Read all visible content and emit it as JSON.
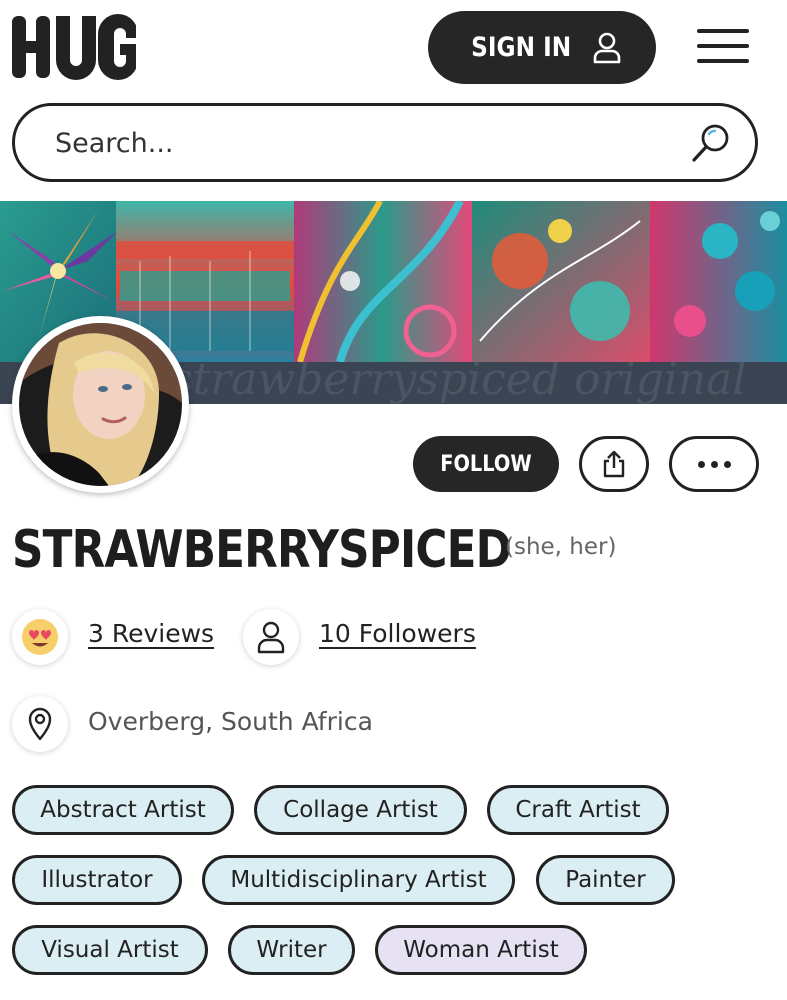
{
  "header": {
    "logo_text": "HUG",
    "signin_label": "SIGN IN",
    "menu_icon": "hamburger-icon"
  },
  "search": {
    "placeholder": "Search...",
    "icon": "search-icon"
  },
  "banner": {
    "watermark_text": "strawberryspiced original"
  },
  "profile": {
    "username": "STRAWBERRYSPICED",
    "pronouns": "(she, her)",
    "follow_label": "FOLLOW",
    "reviews_label": "3 Reviews",
    "followers_label": "10 Followers",
    "location": "Overberg, South Africa"
  },
  "tags": [
    {
      "label": "Abstract Artist"
    },
    {
      "label": "Collage Artist"
    },
    {
      "label": "Craft Artist"
    },
    {
      "label": "Illustrator"
    },
    {
      "label": "Multidisciplinary Artist"
    },
    {
      "label": "Painter"
    },
    {
      "label": "Visual Artist"
    },
    {
      "label": "Writer"
    },
    {
      "label": "Woman Artist"
    }
  ],
  "colors": {
    "dark": "#262626",
    "tag_blue": "#dbeef3",
    "tag_purple": "#e7e2f3",
    "banner_band": "#3a4452"
  }
}
